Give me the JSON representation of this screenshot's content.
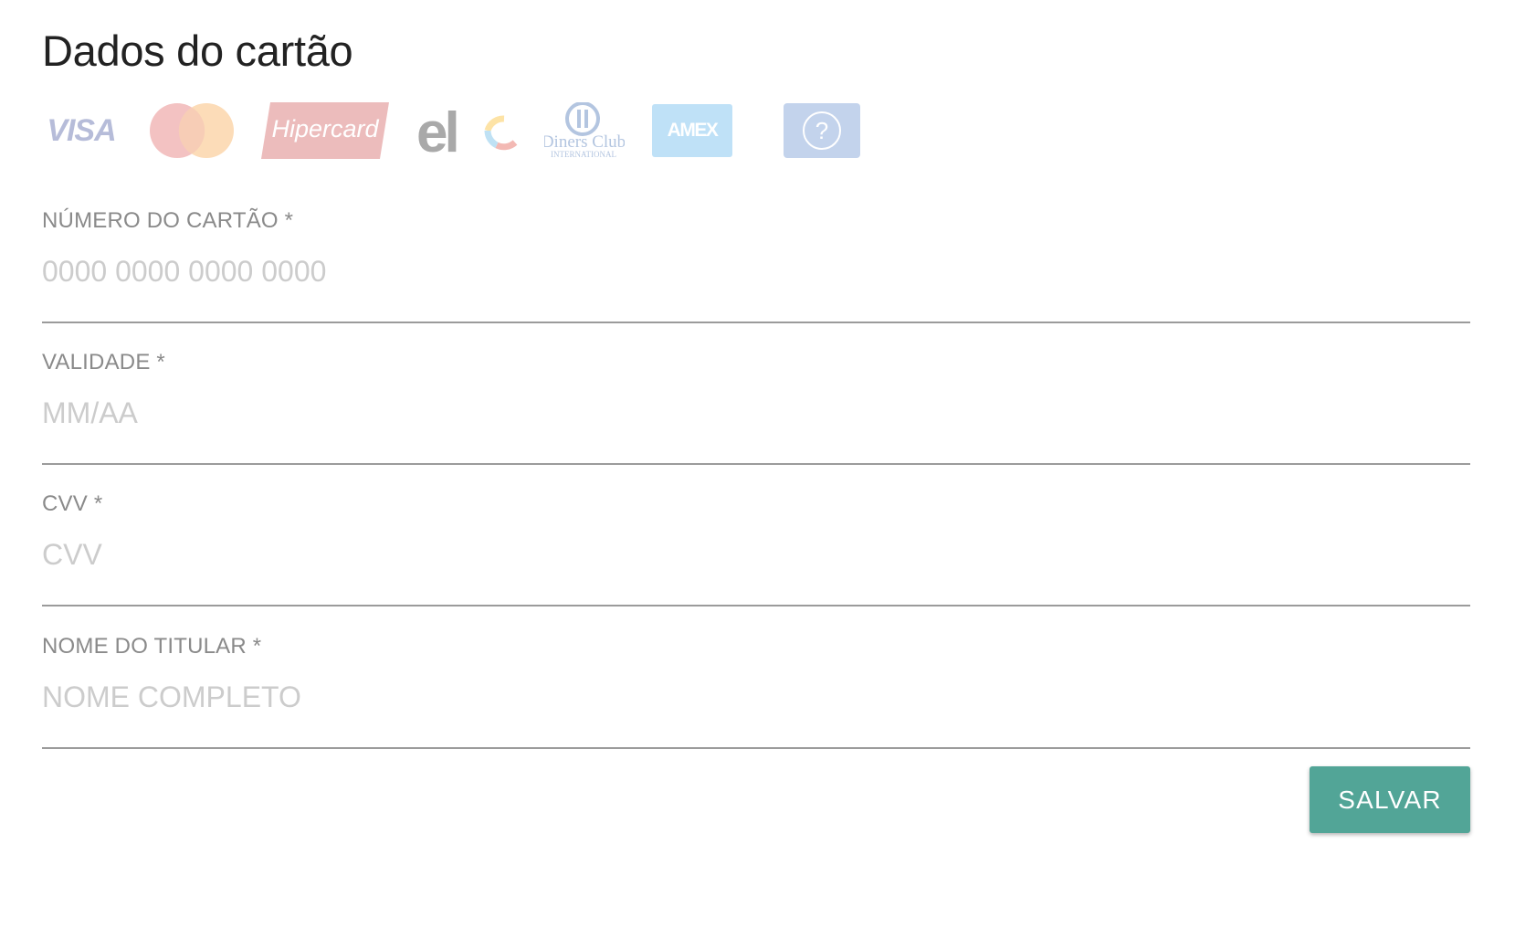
{
  "form": {
    "title": "Dados do cartão",
    "save_label": "SALVAR",
    "colors": {
      "accent": "#52a597"
    }
  },
  "brands": [
    {
      "name": "visa",
      "text": "VISA",
      "icon": "visa-icon"
    },
    {
      "name": "mastercard",
      "icon": "mastercard-icon"
    },
    {
      "name": "hipercard",
      "text": "Hipercard",
      "icon": "hipercard-icon"
    },
    {
      "name": "elo",
      "text": "elo",
      "icon": "elo-icon"
    },
    {
      "name": "diners",
      "text": "Diners Club",
      "subtext": "INTERNATIONAL",
      "icon": "diners-club-icon"
    },
    {
      "name": "amex",
      "text": "AMEX",
      "icon": "amex-icon"
    },
    {
      "name": "other",
      "text": "?",
      "icon": "question-icon"
    }
  ],
  "fields": {
    "card_number": {
      "label": "NÚMERO DO CARTÃO *",
      "placeholder": "0000 0000 0000 0000",
      "value": ""
    },
    "expiry": {
      "label": "VALIDADE *",
      "placeholder": "MM/AA",
      "value": ""
    },
    "cvv": {
      "label": "CVV *",
      "placeholder": "CVV",
      "value": ""
    },
    "holder_name": {
      "label": "NOME DO TITULAR *",
      "placeholder": "NOME COMPLETO",
      "value": ""
    }
  }
}
